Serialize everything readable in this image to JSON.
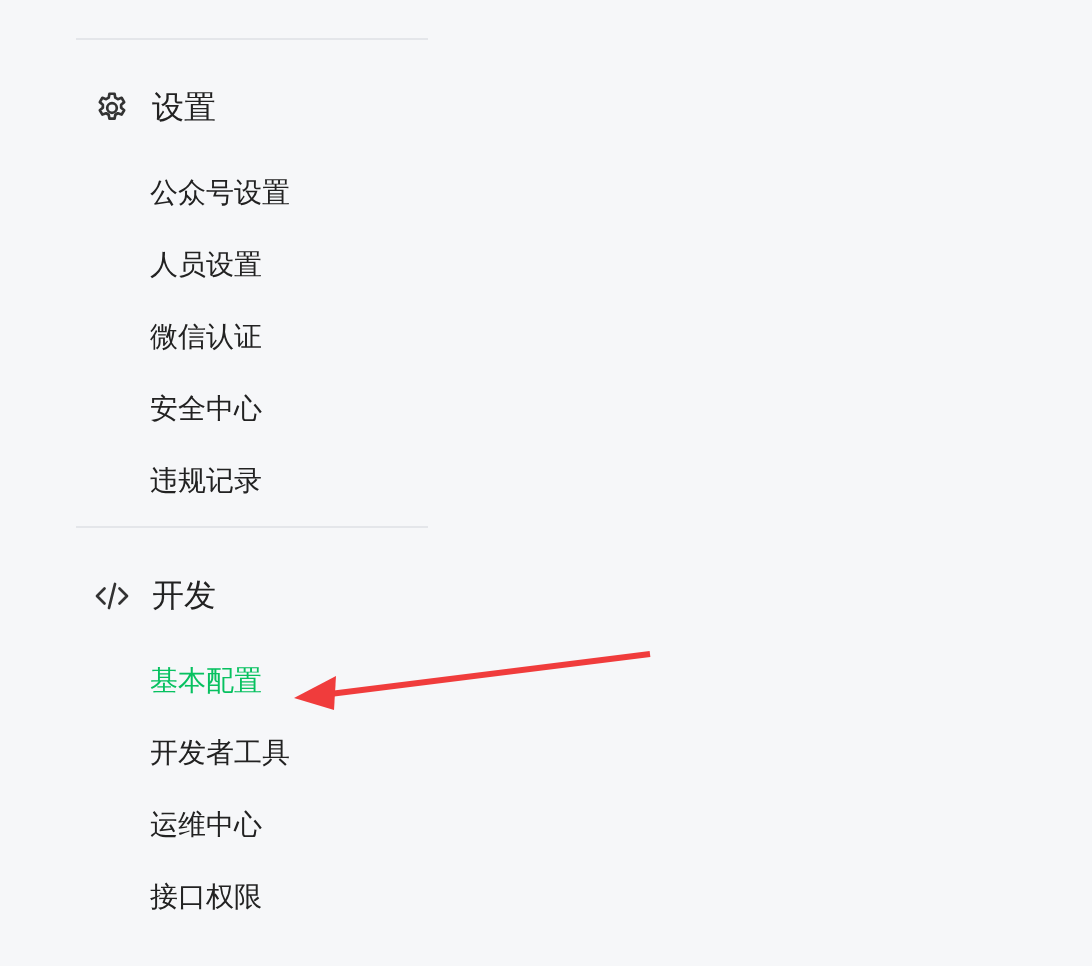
{
  "sections": [
    {
      "kind": "gear",
      "title": "设置",
      "items": [
        {
          "label": "公众号设置",
          "selected": false
        },
        {
          "label": "人员设置",
          "selected": false
        },
        {
          "label": "微信认证",
          "selected": false
        },
        {
          "label": "安全中心",
          "selected": false
        },
        {
          "label": "违规记录",
          "selected": false
        }
      ]
    },
    {
      "kind": "code",
      "title": "开发",
      "items": [
        {
          "label": "基本配置",
          "selected": true
        },
        {
          "label": "开发者工具",
          "selected": false
        },
        {
          "label": "运维中心",
          "selected": false
        },
        {
          "label": "接口权限",
          "selected": false
        }
      ]
    }
  ]
}
